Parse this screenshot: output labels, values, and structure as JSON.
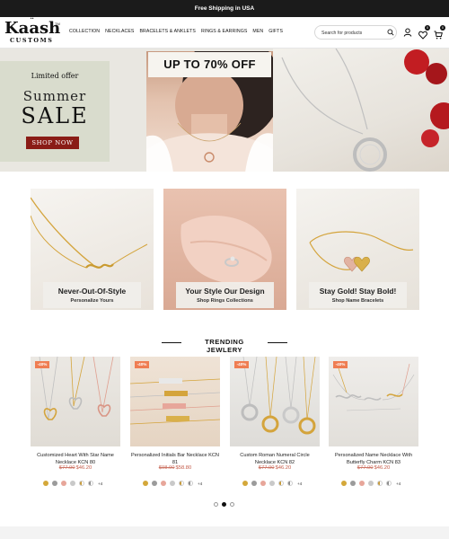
{
  "announcement": "Free Shipping in USA",
  "brand": {
    "name": "Kaash",
    "sub": "CUSTOMS",
    "tm": "TM"
  },
  "nav": [
    "COLLECTION",
    "NECKLACES",
    "BRACELETS & ANKLETS",
    "RINGS & EARRINGS",
    "MEN",
    "GIFTS"
  ],
  "search": {
    "placeholder": "Search for products"
  },
  "header_icons": {
    "user": "user-icon",
    "wishlist": "heart-icon",
    "cart": "cart-icon",
    "wishlist_count": "0",
    "cart_count": "0"
  },
  "hero": {
    "limited": "Limited offer",
    "summer": "Summer",
    "sale": "SALE",
    "cta": "SHOP NOW",
    "promo": "UP TO 70% OFF"
  },
  "categories": [
    {
      "title": "Never-Out-Of-Style",
      "sub": "Personalize Yours"
    },
    {
      "title": "Your Style Our Design",
      "sub": "Shop Rings Collections"
    },
    {
      "title": "Stay Gold! Stay Bold!",
      "sub": "Shop Name Bracelets"
    }
  ],
  "trending": {
    "title": "TRENDING JEWLERY",
    "products": [
      {
        "discount": "-40%",
        "name_line1": "Customized Heart With Star Name",
        "name_line2": "Necklace KCN 80",
        "old_price": "$77.00",
        "price": "$46.20",
        "more": "+4"
      },
      {
        "discount": "-40%",
        "name_line1": "Personalized Initials Bar Necklace KCN",
        "name_line2": "81",
        "old_price": "$98.00",
        "price": "$58.80",
        "more": "+4"
      },
      {
        "discount": "-40%",
        "name_line1": "Custom Roman Numeral Circle",
        "name_line2": "Necklace KCN 82",
        "old_price": "$77.00",
        "price": "$46.20",
        "more": "+4"
      },
      {
        "discount": "-40%",
        "name_line1": "Personalized Name Necklace With",
        "name_line2": "Butterfly Charm KCN 83",
        "old_price": "$77.00",
        "price": "$46.20",
        "more": "+4"
      }
    ],
    "swatch_colors": [
      "#d4a83a",
      "#9b9b9b",
      "#e7a69a",
      "#c9c9c9",
      "#c79a3a",
      "#8c8c8c"
    ],
    "carousel": {
      "pages": 3,
      "active": 2
    }
  },
  "colors": {
    "announcement_bg": "#1b1b1b",
    "cta_bg": "#8a1c16",
    "discount_badge": "#ef7d52",
    "sale_price": "#c45b49"
  }
}
